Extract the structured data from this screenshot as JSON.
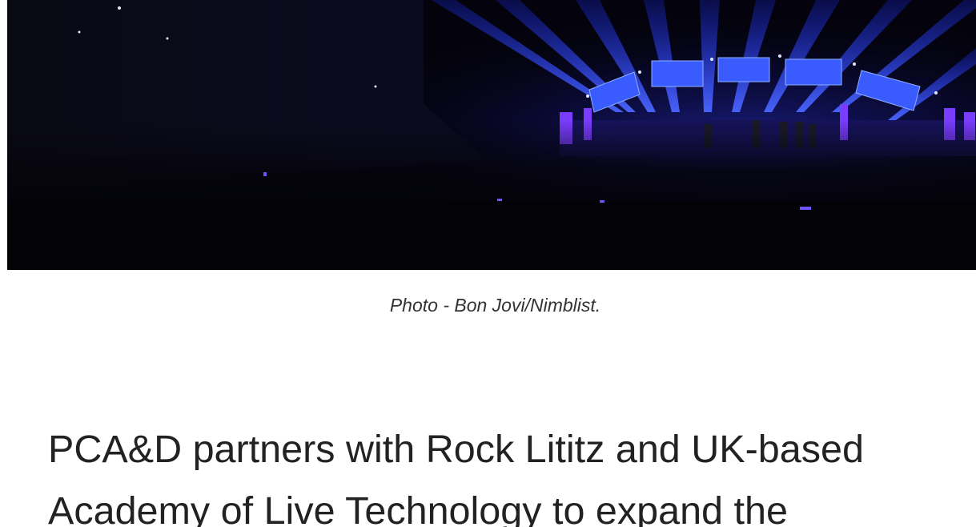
{
  "article": {
    "hero_image": {
      "subject": "concert-stage-photo"
    },
    "caption": "Photo - Bon Jovi/Nimblist.",
    "headline": "PCA&D partners with Rock Lititz and UK-based Academy of Live Technology to expand the"
  },
  "colors": {
    "background": "#ffffff",
    "caption_text": "#333333",
    "headline_text": "#222222",
    "stage_light": "#2a3cff"
  }
}
